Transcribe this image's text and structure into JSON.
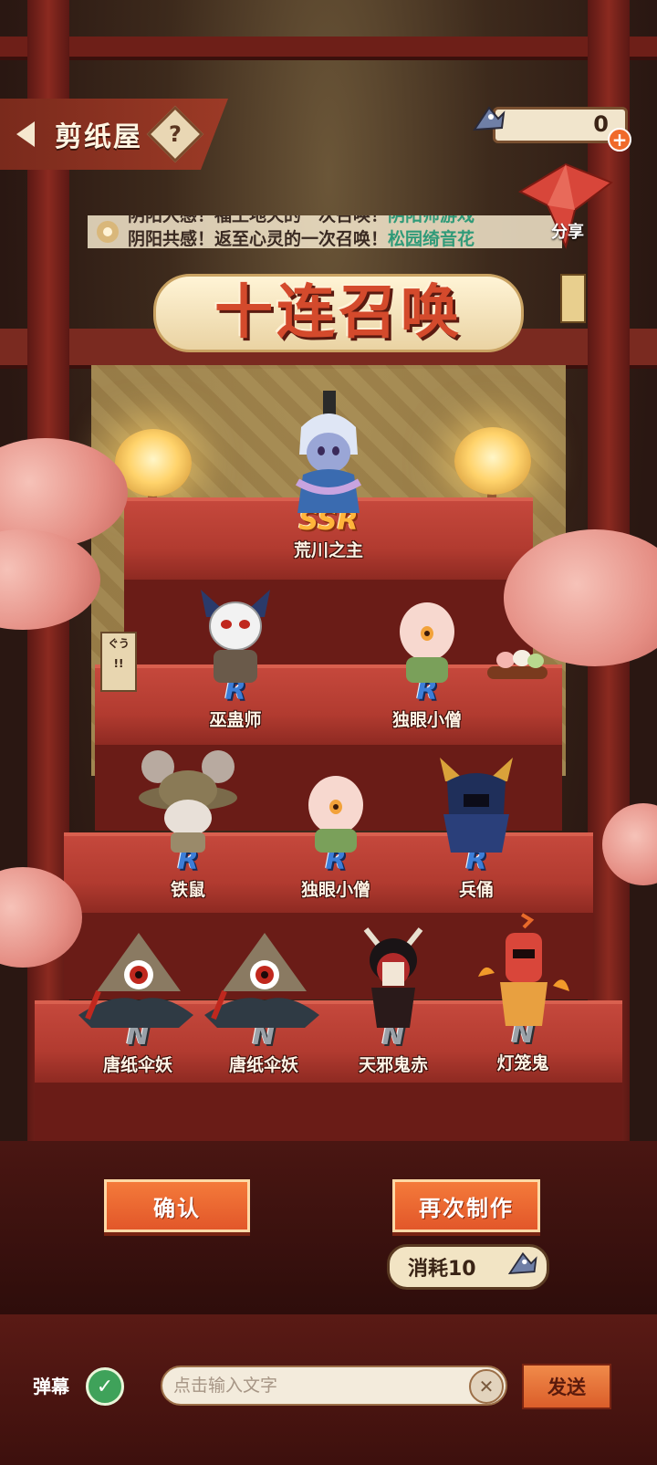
{
  "header": {
    "title": "剪纸屋",
    "help_symbol": "?",
    "currency_value": "0",
    "plus_symbol": "+"
  },
  "marquee": {
    "line1_prefix": "阴阳大感！福王地天的一次召唤！",
    "line1_highlight": "阴阳师游戏",
    "line2_prefix": "阴阳共感！返至心灵的一次召唤！",
    "line2_highlight": "松园绮音花"
  },
  "share_label": "分享",
  "banner_title": "十连召唤",
  "results": [
    {
      "rarity": "SSR",
      "name": "荒川之主"
    },
    {
      "rarity": "R",
      "name": "巫蛊师"
    },
    {
      "rarity": "R",
      "name": "独眼小僧"
    },
    {
      "rarity": "R",
      "name": "铁鼠"
    },
    {
      "rarity": "R",
      "name": "独眼小僧"
    },
    {
      "rarity": "R",
      "name": "兵俑"
    },
    {
      "rarity": "N",
      "name": "唐纸伞妖"
    },
    {
      "rarity": "N",
      "name": "唐纸伞妖"
    },
    {
      "rarity": "N",
      "name": "天邪鬼赤"
    },
    {
      "rarity": "N",
      "name": "灯笼鬼"
    }
  ],
  "sign_text": "ぐう\n!!",
  "buttons": {
    "confirm": "确认",
    "again": "再次制作"
  },
  "cost_label": "消耗10",
  "bottom_bar": {
    "danmu_label": "弹幕",
    "check_symbol": "✓",
    "input_placeholder": "点击输入文字",
    "clear_symbol": "✕",
    "send_label": "发送"
  },
  "colors": {
    "accent": "#e2572a",
    "ssr": "#ffb43a",
    "r": "#3d7ed8",
    "n": "#9aa1a8"
  }
}
